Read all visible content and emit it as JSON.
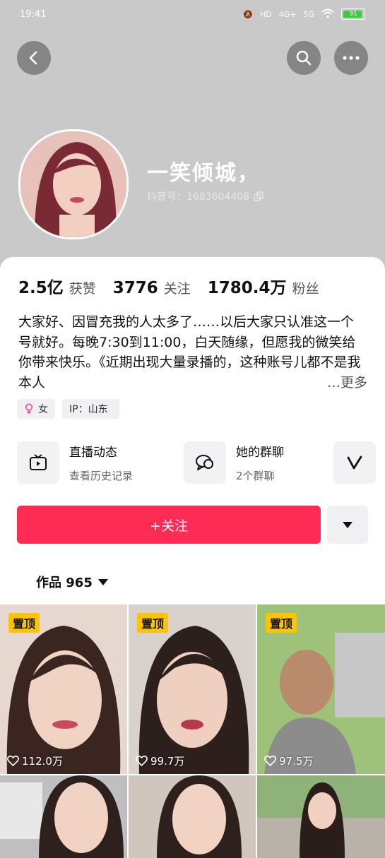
{
  "status_bar": {
    "time": "19:41",
    "signal_labels": [
      "HD",
      "4G+",
      "5G"
    ],
    "battery": "91"
  },
  "profile": {
    "nickname": "一笑倾城，",
    "douyin_id": "抖音号：1683604408",
    "stats": [
      {
        "value": "2.5亿",
        "label": "获赞"
      },
      {
        "value": "3776",
        "label": "关注"
      },
      {
        "value": "1780.4万",
        "label": "粉丝"
      }
    ],
    "bio": "大家好、因冒充我的人太多了……以后大家只认准这一个号就好。每晚7:30到11:00，白天随缘，但愿我的微笑给你带来快乐。《近期出现大量录播的，这种账号儿都不是我本人",
    "bio_more": "…更多",
    "tags": [
      {
        "icon": "female-icon",
        "label": "女"
      },
      {
        "icon": "",
        "label": "IP：山东"
      }
    ]
  },
  "features": [
    {
      "title": "直播动态",
      "subtitle": "查看历史记录",
      "icon": "tv-icon"
    },
    {
      "title": "她的群聊",
      "subtitle": "2个群聊",
      "icon": "chat-bubbles-icon"
    }
  ],
  "actions": {
    "follow_label": "+关注"
  },
  "works_tab": {
    "label": "作品 965"
  },
  "works": [
    {
      "pinned": "置顶",
      "likes": "112.0万"
    },
    {
      "pinned": "置顶",
      "likes": "99.7万"
    },
    {
      "pinned": "置顶",
      "likes": "97.5万"
    },
    {
      "pinned": "",
      "likes": ""
    },
    {
      "pinned": "",
      "likes": ""
    },
    {
      "pinned": "",
      "likes": ""
    }
  ],
  "colors": {
    "accent": "#fe2c55",
    "pin_badge": "#ffc300",
    "hero_bg": "#c9c9c9"
  }
}
